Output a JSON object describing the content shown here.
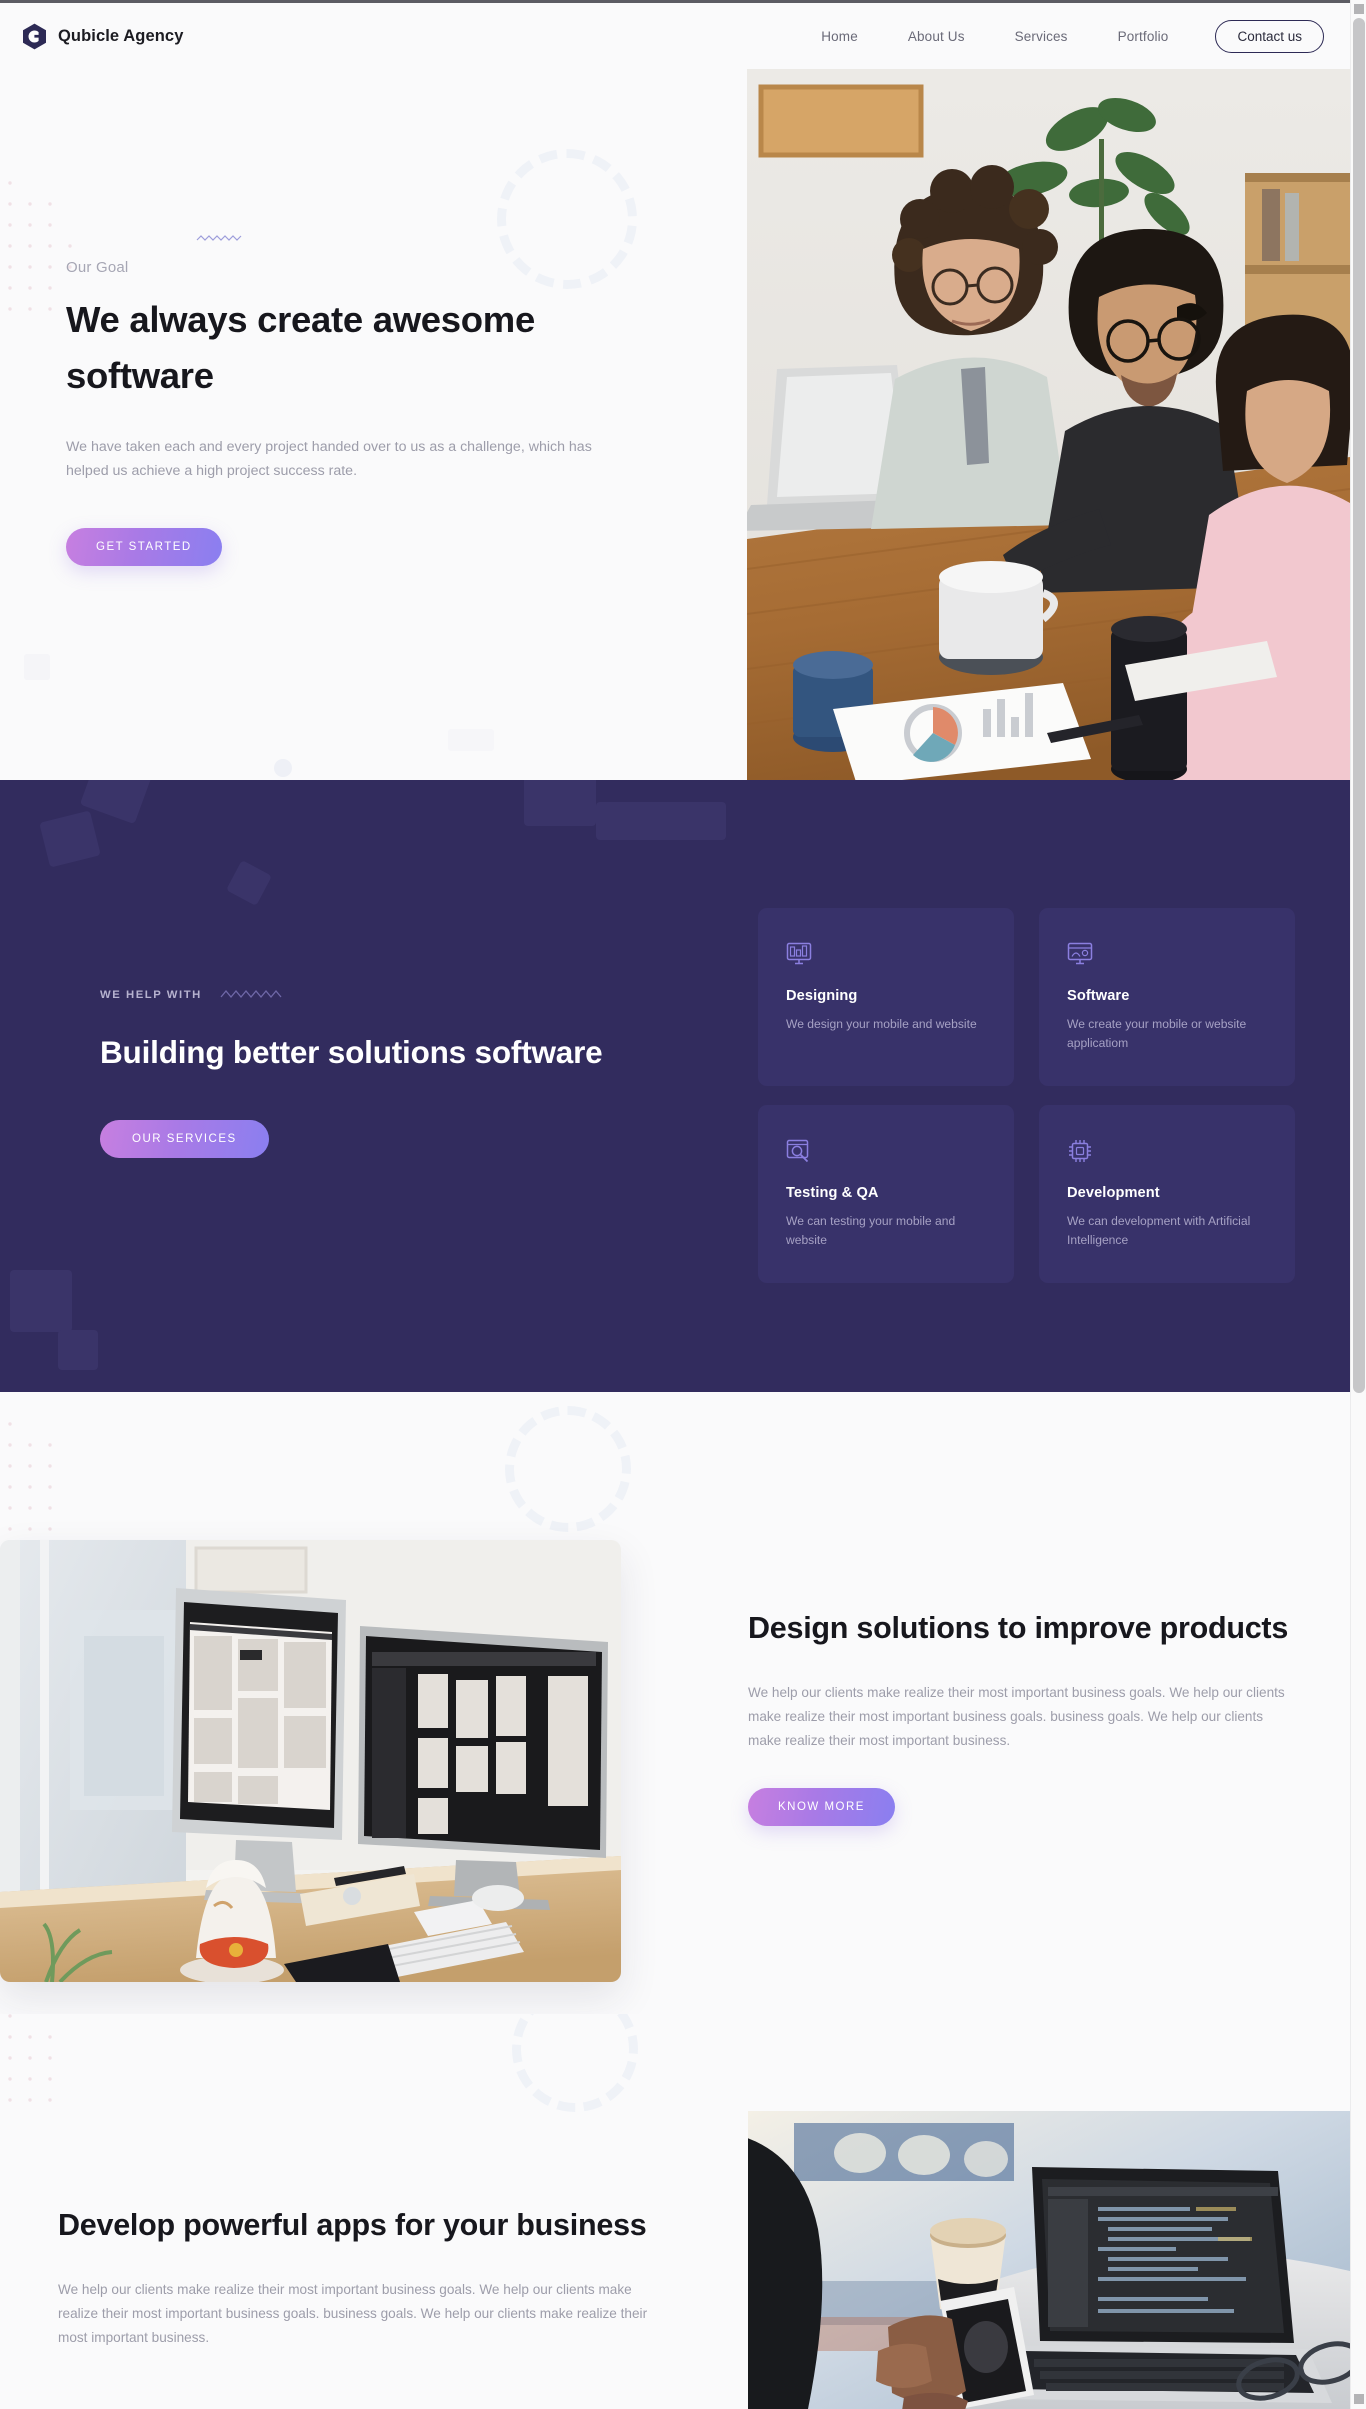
{
  "brand": {
    "name": "Qubicle Agency",
    "logo_icon": "hexagon-logo-icon"
  },
  "nav": {
    "links": [
      {
        "label": "Home"
      },
      {
        "label": "About Us"
      },
      {
        "label": "Services"
      },
      {
        "label": "Portfolio"
      }
    ],
    "cta_label": "Contact us"
  },
  "hero": {
    "eyebrow": "Our Goal",
    "title": "We always create awesome software",
    "subtitle": "We have taken each and every project handed over to us as a challenge, which has helped us achieve a high project success rate.",
    "cta_label": "GET STARTED",
    "image_alt": "team-meeting-photo"
  },
  "services": {
    "eyebrow": "WE HELP WITH",
    "title": "Building better solutions software",
    "cta_label": "OUR SERVICES",
    "cards": [
      {
        "icon": "monitor-design-icon",
        "title": "Designing",
        "desc": "We design your mobile and website"
      },
      {
        "icon": "monitor-software-icon",
        "title": "Software",
        "desc": "We create your mobile or website applicatiom"
      },
      {
        "icon": "magnifier-testing-icon",
        "title": "Testing & QA",
        "desc": "We can testing your mobile and website"
      },
      {
        "icon": "chip-development-icon",
        "title": "Development",
        "desc": "We can development with Artificial Intelligence"
      }
    ]
  },
  "design_section": {
    "title": "Design solutions to improve products",
    "body": "We help our clients make realize their most important business goals. We help our clients make realize their most important business goals. business goals. We help our clients make realize their most important business.",
    "cta_label": "KNOW MORE",
    "image_alt": "desk-with-two-monitors-photo"
  },
  "develop_section": {
    "title": "Develop powerful apps for your business",
    "body": "We help our clients make realize their most important business goals. We help our clients make realize their most important business goals. business goals. We help our clients make realize their most important business.",
    "image_alt": "laptop-with-code-and-phone-photo"
  },
  "colors": {
    "purple_section": "#322C5E",
    "card_bg": "#38326A",
    "accent_gradient_start": "#C77FE0",
    "accent_gradient_end": "#8A7FF0",
    "page_bg": "#FAFAFB",
    "heading": "#17171D",
    "muted_text": "#9D9DAA"
  }
}
